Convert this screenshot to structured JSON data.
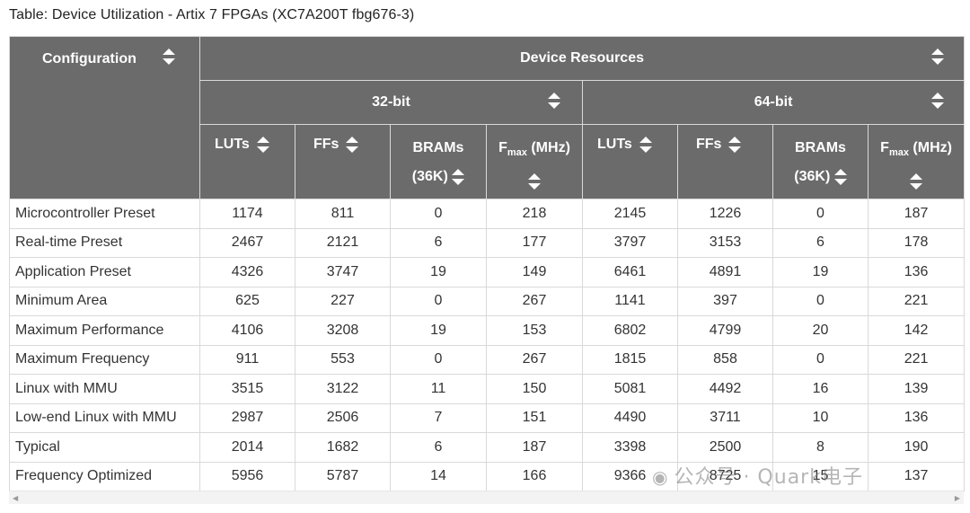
{
  "caption": "Table: Device Utilization - Artix 7 FPGAs (XC7A200T fbg676-3)",
  "headers": {
    "configuration": "Configuration",
    "device_resources": "Device Resources",
    "bit32": "32-bit",
    "bit64": "64-bit",
    "luts": "LUTs",
    "ffs": "FFs",
    "brams_line1": "BRAMs",
    "brams_line2": "(36K)",
    "fmax_F": "F",
    "fmax_sub": "max",
    "fmax_rest": " (MHz)"
  },
  "rows": [
    [
      "Microcontroller Preset",
      "1174",
      "811",
      "0",
      "218",
      "2145",
      "1226",
      "0",
      "187"
    ],
    [
      "Real-time Preset",
      "2467",
      "2121",
      "6",
      "177",
      "3797",
      "3153",
      "6",
      "178"
    ],
    [
      "Application Preset",
      "4326",
      "3747",
      "19",
      "149",
      "6461",
      "4891",
      "19",
      "136"
    ],
    [
      "Minimum Area",
      "625",
      "227",
      "0",
      "267",
      "1141",
      "397",
      "0",
      "221"
    ],
    [
      "Maximum Performance",
      "4106",
      "3208",
      "19",
      "153",
      "6802",
      "4799",
      "20",
      "142"
    ],
    [
      "Maximum Frequency",
      "911",
      "553",
      "0",
      "267",
      "1815",
      "858",
      "0",
      "221"
    ],
    [
      "Linux with MMU",
      "3515",
      "3122",
      "11",
      "150",
      "5081",
      "4492",
      "16",
      "139"
    ],
    [
      "Low-end Linux with MMU",
      "2987",
      "2506",
      "7",
      "151",
      "4490",
      "3711",
      "10",
      "136"
    ],
    [
      "Typical",
      "2014",
      "1682",
      "6",
      "187",
      "3398",
      "2500",
      "8",
      "190"
    ],
    [
      "Frequency Optimized",
      "5956",
      "5787",
      "14",
      "166",
      "9366",
      "8725",
      "15",
      "137"
    ]
  ],
  "scrollbar": {
    "left_arrow": "◀",
    "right_arrow": "▶"
  },
  "watermark": "公众号 · Quark电子",
  "colors": {
    "header_bg": "#6b6b6b",
    "border": "#d9d9d9",
    "text": "#333333"
  }
}
